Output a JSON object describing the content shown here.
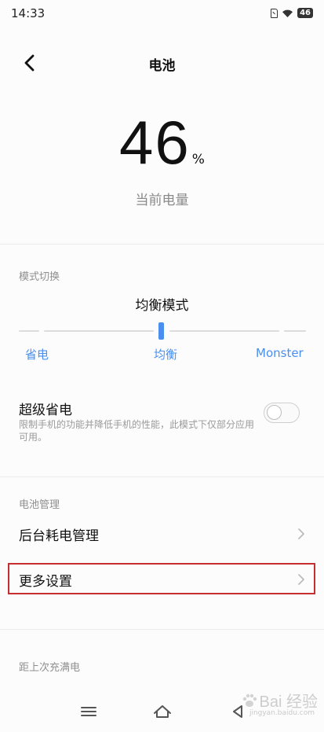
{
  "status_bar": {
    "time": "14:33",
    "battery_badge": "46",
    "icons": [
      "sim-card-icon",
      "wifi-icon",
      "battery-icon"
    ]
  },
  "header": {
    "title": "电池",
    "back_icon": "chevron-left-icon"
  },
  "battery": {
    "level": "46",
    "unit": "%",
    "caption": "当前电量"
  },
  "mode_switch": {
    "section_title": "模式切换",
    "current_mode": "均衡模式",
    "options": [
      "省电",
      "均衡",
      "Monster"
    ],
    "selected_index": 1,
    "accent_color": "#4a8ff0"
  },
  "super_saver": {
    "title": "超级省电",
    "description": "限制手机的功能并降低手机的性能，此模式下仅部分应用可用。",
    "enabled": false
  },
  "battery_management": {
    "section_title": "电池管理",
    "items": [
      {
        "label": "后台耗电管理",
        "icon": "chevron-right-icon"
      },
      {
        "label": "更多设置",
        "icon": "chevron-right-icon",
        "highlighted": true
      }
    ],
    "highlight_color": "#c62f2f"
  },
  "last_charge": {
    "section_title": "距上次充满电"
  },
  "nav_bar": {
    "buttons": [
      "menu-icon",
      "home-icon",
      "back-icon"
    ]
  },
  "watermark": {
    "text": "Bai 经验",
    "subtext": "jingyan.baidu.com"
  }
}
